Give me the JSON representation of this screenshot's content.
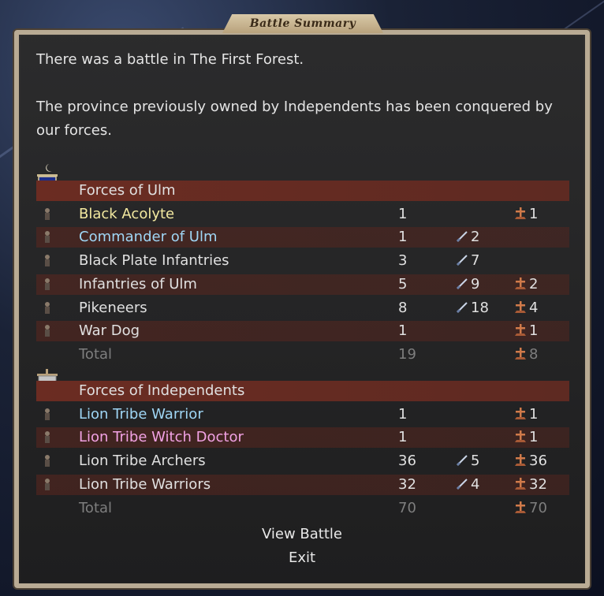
{
  "window": {
    "title": "Battle Summary"
  },
  "messages": {
    "line1": "There was a battle in The First Forest.",
    "line2": "The province previously owned by Independents has been conquered by our forces."
  },
  "sides": [
    {
      "name": "Forces of Ulm",
      "banner_color": "#1c2e8c",
      "units": [
        {
          "name": "Black Acolyte",
          "color": "yellow",
          "count": "1",
          "kills": "",
          "losses": "1"
        },
        {
          "name": "Commander of Ulm",
          "color": "blue",
          "count": "1",
          "kills": "2",
          "losses": ""
        },
        {
          "name": "Black Plate Infantries",
          "color": "white",
          "count": "3",
          "kills": "7",
          "losses": ""
        },
        {
          "name": "Infantries of Ulm",
          "color": "white",
          "count": "5",
          "kills": "9",
          "losses": "2"
        },
        {
          "name": "Pikeneers",
          "color": "white",
          "count": "8",
          "kills": "18",
          "losses": "4"
        },
        {
          "name": "War Dog",
          "color": "white",
          "count": "1",
          "kills": "",
          "losses": "1"
        }
      ],
      "total": {
        "label": "Total",
        "count": "19",
        "losses": "8"
      }
    },
    {
      "name": "Forces of Independents",
      "banner_color": "#bfbfbf",
      "units": [
        {
          "name": "Lion Tribe Warrior",
          "color": "blue",
          "count": "1",
          "kills": "",
          "losses": "1"
        },
        {
          "name": "Lion Tribe Witch Doctor",
          "color": "pink",
          "count": "1",
          "kills": "",
          "losses": "1"
        },
        {
          "name": "Lion Tribe Archers",
          "color": "white",
          "count": "36",
          "kills": "5",
          "losses": "36"
        },
        {
          "name": "Lion Tribe Warriors",
          "color": "white",
          "count": "32",
          "kills": "4",
          "losses": "32"
        }
      ],
      "total": {
        "label": "Total",
        "count": "70",
        "losses": "70"
      }
    }
  ],
  "buttons": {
    "view_battle": "View Battle",
    "exit": "Exit"
  },
  "colors": {
    "header_row": "#6b2c22",
    "shaded_row": "#5c261e",
    "frame": "#b9ab94"
  }
}
